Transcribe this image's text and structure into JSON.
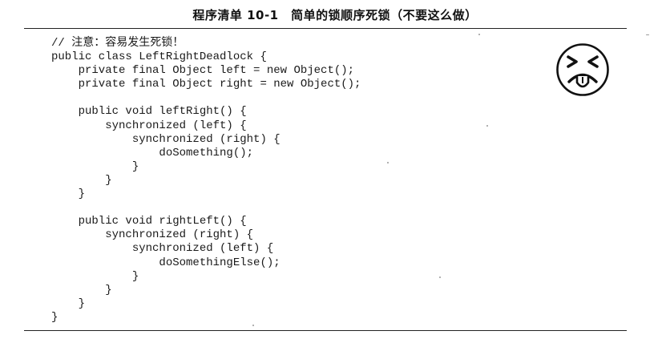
{
  "listing": {
    "title": "程序清单 10-1　简单的锁顺序死锁（不要这么做）"
  },
  "code_lines": [
    "// 注意：容易发生死锁！",
    "public class LeftRightDeadlock {",
    "    private final Object left = new Object();",
    "    private final Object right = new Object();",
    "",
    "    public void leftRight() {",
    "        synchronized (left) {",
    "            synchronized (right) {",
    "                doSomething();",
    "            }",
    "        }",
    "    }",
    "",
    "    public void rightLeft() {",
    "        synchronized (right) {",
    "            synchronized (left) {",
    "                doSomethingElse();",
    "            }",
    "        }",
    "    }",
    "}"
  ],
  "icons": {
    "warning_face": "grimacing-face-icon"
  }
}
